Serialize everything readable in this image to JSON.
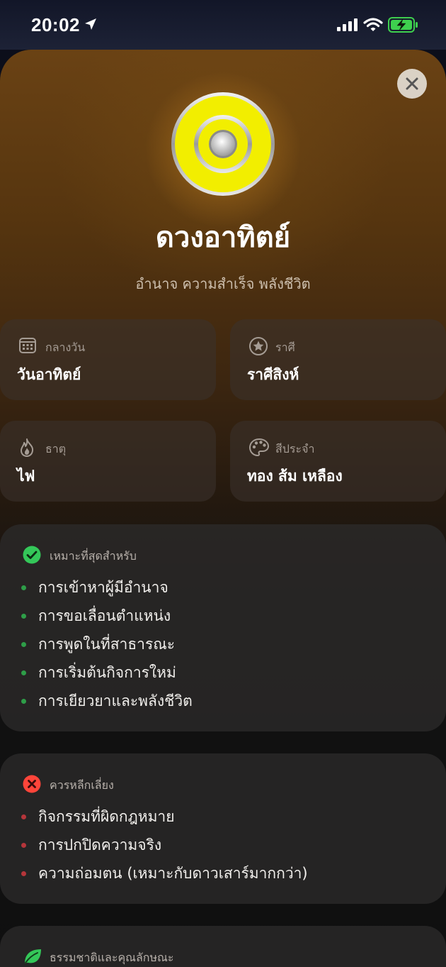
{
  "status": {
    "time": "20:02"
  },
  "planet": {
    "name": "ดวงอาทิตย์",
    "keywords": "อำนาจ ความสำเร็จ พลังชีวิต"
  },
  "info": [
    {
      "icon": "calendar-icon",
      "label": "กลางวัน",
      "value": "วันอาทิตย์"
    },
    {
      "icon": "star-icon",
      "label": "ราศี",
      "value": "ราศีสิงห์"
    },
    {
      "icon": "flame-icon",
      "label": "ธาตุ",
      "value": "ไฟ"
    },
    {
      "icon": "palette-icon",
      "label": "สีประจำ",
      "value": "ทอง ส้ม เหลือง"
    }
  ],
  "best_for": {
    "title": "เหมาะที่สุดสำหรับ",
    "items": [
      "การเข้าหาผู้มีอำนาจ",
      "การขอเลื่อนตำแหน่ง",
      "การพูดในที่สาธารณะ",
      "การเริ่มต้นกิจการใหม่",
      "การเยียวยาและพลังชีวิต"
    ]
  },
  "avoid": {
    "title": "ควรหลีกเลี่ยง",
    "items": [
      "กิจกรรมที่ผิดกฎหมาย",
      "การปกปิดความจริง",
      "ความถ่อมตน (เหมาะกับดาวเสาร์มากกว่า)"
    ]
  },
  "nature": {
    "title": "ธรรมชาติและคุณลักษณะ"
  },
  "colors": {
    "accent_yellow": "#f2ee00",
    "good_green": "#34c759",
    "bad_red": "#ff453a"
  }
}
